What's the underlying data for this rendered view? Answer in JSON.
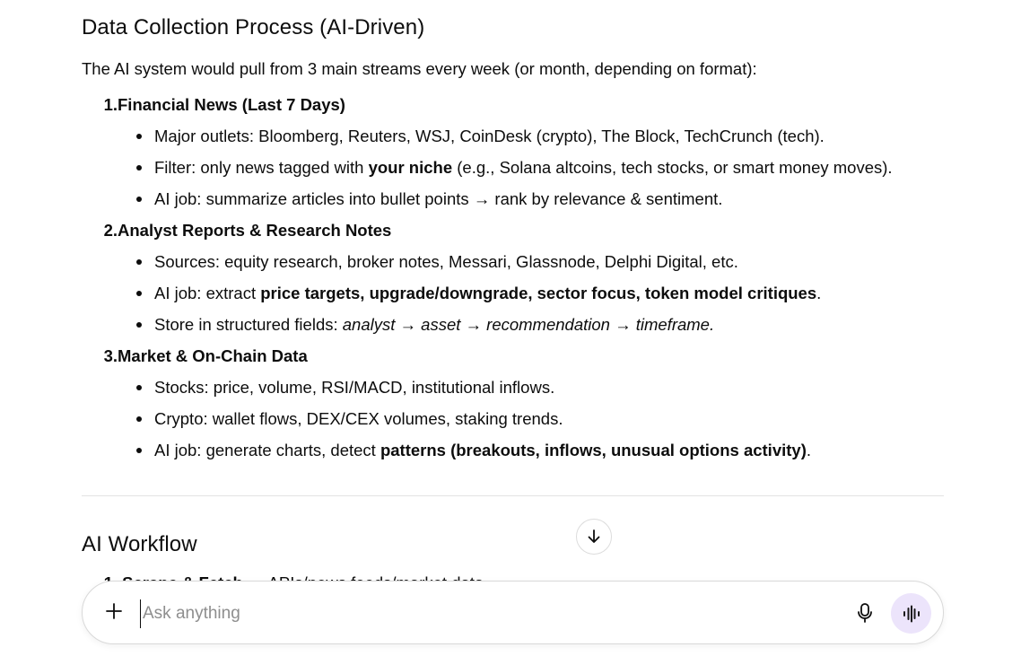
{
  "sections": {
    "collection_heading": "Data Collection Process (AI-Driven)",
    "intro": "The AI system would pull from 3 main streams every week (or month, depending on format):",
    "workflow_heading": "AI Workflow"
  },
  "steps": [
    {
      "number": "1.",
      "title": "Financial News (Last 7 Days)",
      "bullets": [
        {
          "parts": [
            {
              "t": "Major outlets: Bloomberg, Reuters, WSJ, CoinDesk (crypto), The Block, TechCrunch (tech)."
            }
          ]
        },
        {
          "parts": [
            {
              "t": "Filter: only news tagged with "
            },
            {
              "t": "your niche",
              "s": "b"
            },
            {
              "t": " (e.g., Solana altcoins, tech stocks, or smart money moves)."
            }
          ]
        },
        {
          "parts": [
            {
              "t": "AI job: summarize articles into bullet points → rank by relevance & sentiment."
            }
          ]
        }
      ]
    },
    {
      "number": "2.",
      "title": "Analyst Reports & Research Notes",
      "bullets": [
        {
          "parts": [
            {
              "t": "Sources: equity research, broker notes, Messari, Glassnode, Delphi Digital, etc."
            }
          ]
        },
        {
          "parts": [
            {
              "t": "AI job: extract "
            },
            {
              "t": "price targets, upgrade/downgrade, sector focus, token model critiques",
              "s": "b"
            },
            {
              "t": "."
            }
          ]
        },
        {
          "parts": [
            {
              "t": "Store in structured fields: "
            },
            {
              "t": "analyst → asset → recommendation → timeframe.",
              "s": "i"
            }
          ]
        }
      ]
    },
    {
      "number": "3.",
      "title": "Market & On-Chain Data",
      "bullets": [
        {
          "parts": [
            {
              "t": "Stocks: price, volume, RSI/MACD, institutional inflows."
            }
          ]
        },
        {
          "parts": [
            {
              "t": "Crypto: wallet flows, DEX/CEX volumes, staking trends."
            }
          ]
        },
        {
          "parts": [
            {
              "t": "AI job: generate charts, detect "
            },
            {
              "t": "patterns (breakouts, inflows, unusual options activity)",
              "s": "b"
            },
            {
              "t": "."
            }
          ]
        }
      ]
    }
  ],
  "peek_step": {
    "number": "1.",
    "title": "Scrape & Fetch",
    "rest": " → APIs/news feeds/market data"
  },
  "composer": {
    "placeholder": "Ask anything"
  },
  "icons": {
    "scroll": "arrow-down-icon",
    "add": "plus-icon",
    "mic": "microphone-icon",
    "voice": "voice-waveform-icon"
  },
  "colors": {
    "voice_button_bg": "#ece4fb",
    "text": "#0d0d0d",
    "placeholder": "#8e8e8e"
  }
}
